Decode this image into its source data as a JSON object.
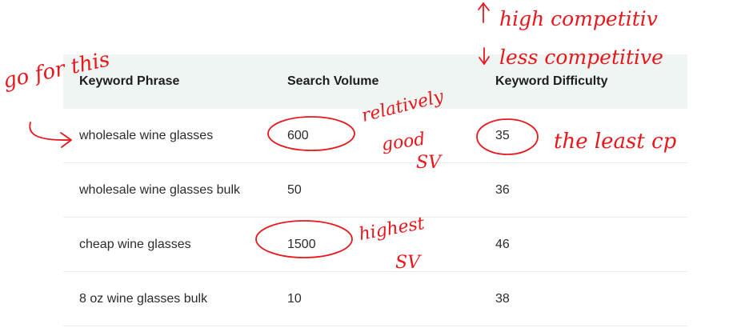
{
  "table": {
    "headers": [
      "Keyword Phrase",
      "Search Volume",
      "Keyword Difficulty"
    ],
    "rows": [
      [
        "wholesale wine glasses",
        "600",
        "35"
      ],
      [
        "wholesale wine glasses bulk",
        "50",
        "36"
      ],
      [
        "cheap wine glasses",
        "1500",
        "46"
      ],
      [
        "8 oz wine glasses bulk",
        "10",
        "38"
      ]
    ]
  },
  "annotations": {
    "go_for_this": "go for this",
    "high_competition": "high competitiv",
    "less_competitive": "less competitive",
    "relatively": "relatively",
    "good": "good",
    "sv1": "SV",
    "the_least_cp": "the least cp",
    "highest": "highest",
    "sv2": "SV"
  },
  "colors": {
    "header_bg": "#eef5f3",
    "annotation": "#e8171c"
  }
}
